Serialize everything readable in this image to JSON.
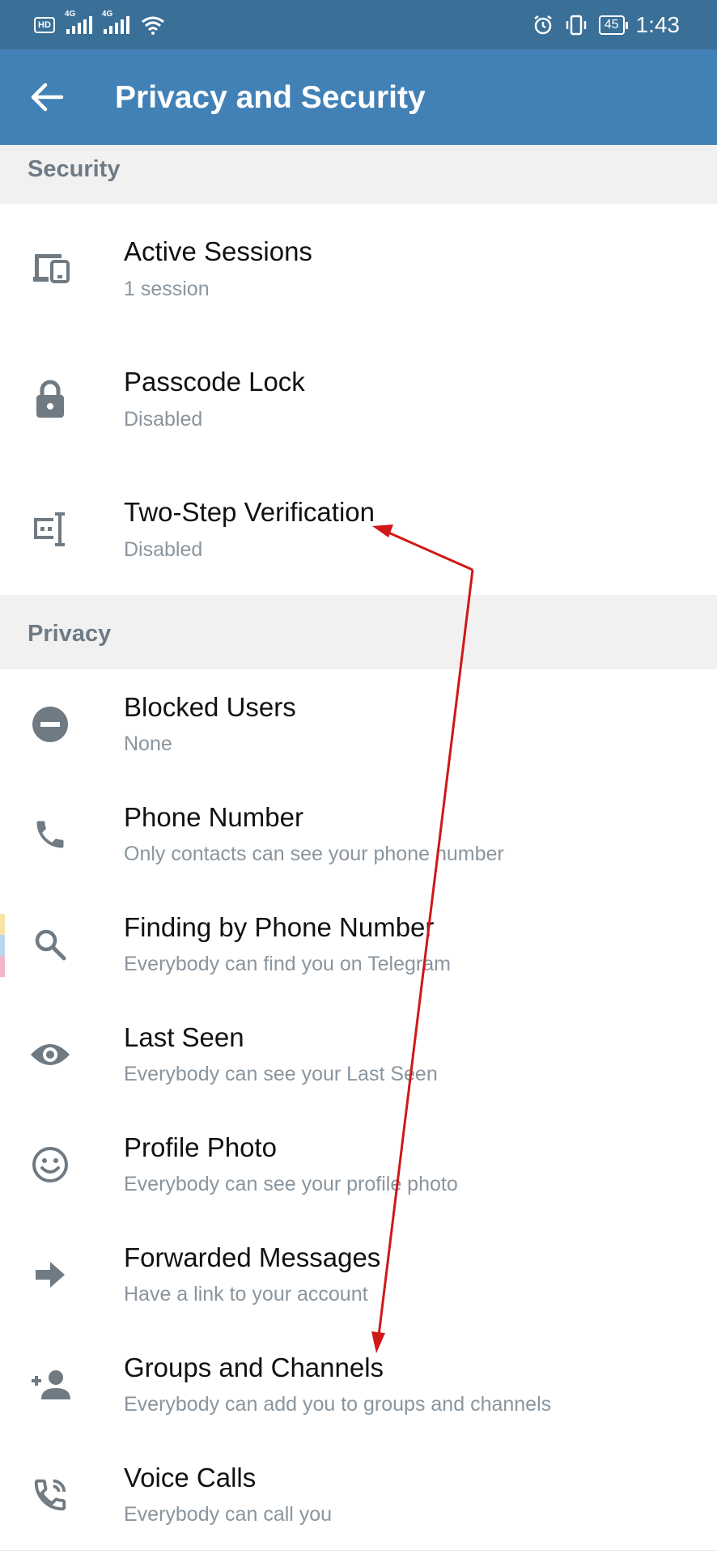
{
  "status_bar": {
    "hd": "HD",
    "net1": "4G",
    "net2": "4G",
    "battery": "45",
    "time": "1:43"
  },
  "app_bar": {
    "title": "Privacy and Security"
  },
  "sections": {
    "security": {
      "label": "Security",
      "items": [
        {
          "title": "Active Sessions",
          "subtitle": "1 session",
          "icon": "devices-icon"
        },
        {
          "title": "Passcode Lock",
          "subtitle": "Disabled",
          "icon": "lock-icon"
        },
        {
          "title": "Two-Step Verification",
          "subtitle": "Disabled",
          "icon": "password-key-icon"
        }
      ]
    },
    "privacy": {
      "label": "Privacy",
      "items": [
        {
          "title": "Blocked Users",
          "subtitle": "None",
          "icon": "block-icon"
        },
        {
          "title": "Phone Number",
          "subtitle": "Only contacts can see your phone number",
          "icon": "phone-icon"
        },
        {
          "title": "Finding by Phone Number",
          "subtitle": "Everybody can find you on Telegram",
          "icon": "search-icon"
        },
        {
          "title": "Last Seen",
          "subtitle": "Everybody can see your Last Seen",
          "icon": "eye-icon"
        },
        {
          "title": "Profile Photo",
          "subtitle": "Everybody can see your profile photo",
          "icon": "smiley-icon"
        },
        {
          "title": "Forwarded Messages",
          "subtitle": "Have a link to your account",
          "icon": "forward-arrow-icon"
        },
        {
          "title": "Groups and Channels",
          "subtitle": "Everybody can add you to groups and channels",
          "icon": "add-person-icon"
        },
        {
          "title": "Voice Calls",
          "subtitle": "Everybody can call you",
          "icon": "phone-call-icon"
        }
      ]
    }
  },
  "colors": {
    "status_bar": "#3a6f97",
    "app_bar": "#4181b6",
    "annotation_arrow": "#d01818",
    "icon_gray": "#6f7a83"
  }
}
